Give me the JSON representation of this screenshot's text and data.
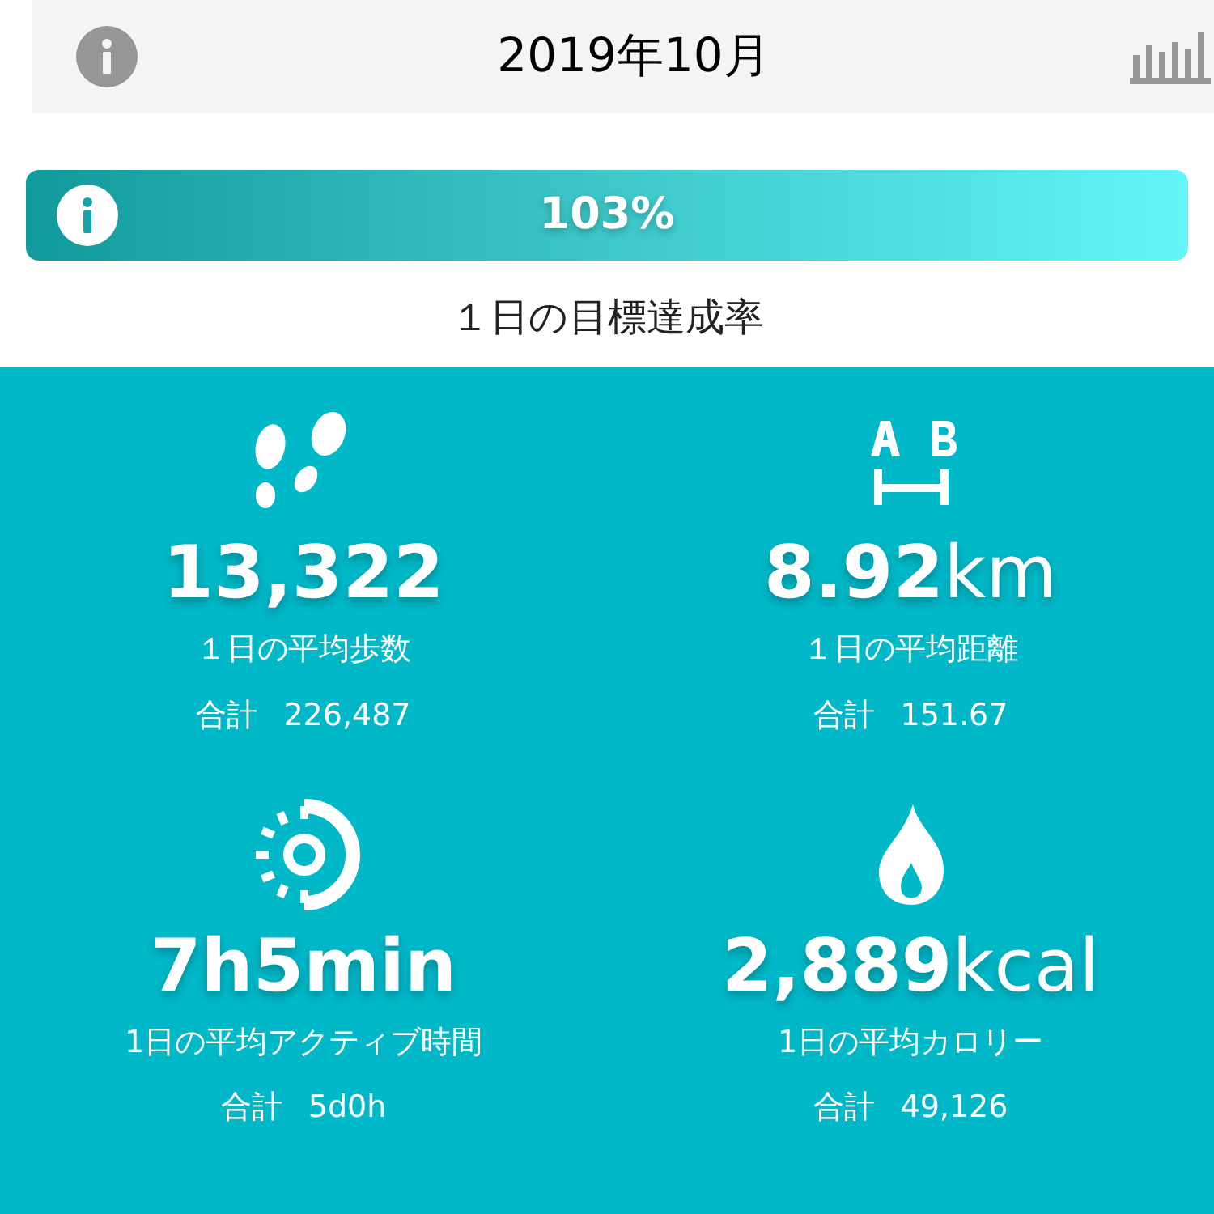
{
  "header": {
    "title": "2019年10月"
  },
  "goal": {
    "percent": "103%",
    "level": 1,
    "caption": "１日の目標達成率"
  },
  "stats": [
    {
      "kind": "steps",
      "value": "13,322",
      "label": "１日の平均歩数",
      "total_label": "合計",
      "total": "226,487"
    },
    {
      "kind": "distance",
      "value": "8.92",
      "unit": "km",
      "label": "１日の平均距離",
      "total_label": "合計",
      "total": "151.67"
    },
    {
      "kind": "active",
      "value": "7h5min",
      "label": "1日の平均アクティブ時間",
      "total_label": "合計",
      "total": "5d0h"
    },
    {
      "kind": "calories",
      "value": "2,889",
      "unit": "kcal",
      "label": "1日の平均カロリー",
      "total_label": "合計",
      "total": "49,126"
    }
  ]
}
